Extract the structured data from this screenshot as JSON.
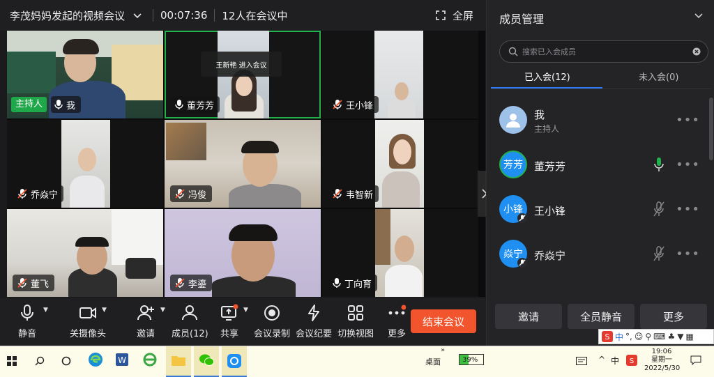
{
  "titlebar": {
    "meeting_title": "李茂妈妈发起的视频会议",
    "timer": "00:07:36",
    "participants": "12人在会议中",
    "fullscreen_label": "全屏"
  },
  "tiles": [
    {
      "name": "我",
      "host_tag": "主持人"
    },
    {
      "name": "董芳芳",
      "toast": "王新艳 进入会议"
    },
    {
      "name": "王小锋"
    },
    {
      "name": "乔焱宁"
    },
    {
      "name": "冯俊"
    },
    {
      "name": "韦智新"
    },
    {
      "name": "董飞"
    },
    {
      "name": "李鎏"
    },
    {
      "name": "丁向育"
    }
  ],
  "toolbar": {
    "mute": "静音",
    "camera": "关摄像头",
    "invite": "邀请",
    "members": "成员(12)",
    "share": "共享",
    "record": "会议录制",
    "minutes": "会议纪要",
    "view": "切换视图",
    "more": "更多",
    "end": "结束会议"
  },
  "panel": {
    "title": "成员管理",
    "search_placeholder": "搜索已入会成员",
    "tab_joined": "已入会(12)",
    "tab_not_joined": "未入会(0)",
    "members": [
      {
        "name": "我",
        "role": "主持人",
        "avatar": ""
      },
      {
        "name": "董芳芳",
        "avatar": "芳芳"
      },
      {
        "name": "王小锋",
        "avatar": "小锋"
      },
      {
        "name": "乔焱宁",
        "avatar": "焱宁"
      }
    ],
    "btn_invite": "邀请",
    "btn_mute_all": "全员静音",
    "btn_more": "更多"
  },
  "taskbar": {
    "desktop": "桌面",
    "battery": "39%",
    "time": "19:06",
    "weekday": "星期一",
    "date": "2022/5/30",
    "ime_lang": "中"
  },
  "colors": {
    "accent": "#2b7cf6",
    "end": "#f2542d",
    "host": "#1fa84a",
    "speaking": "#22b14c"
  }
}
